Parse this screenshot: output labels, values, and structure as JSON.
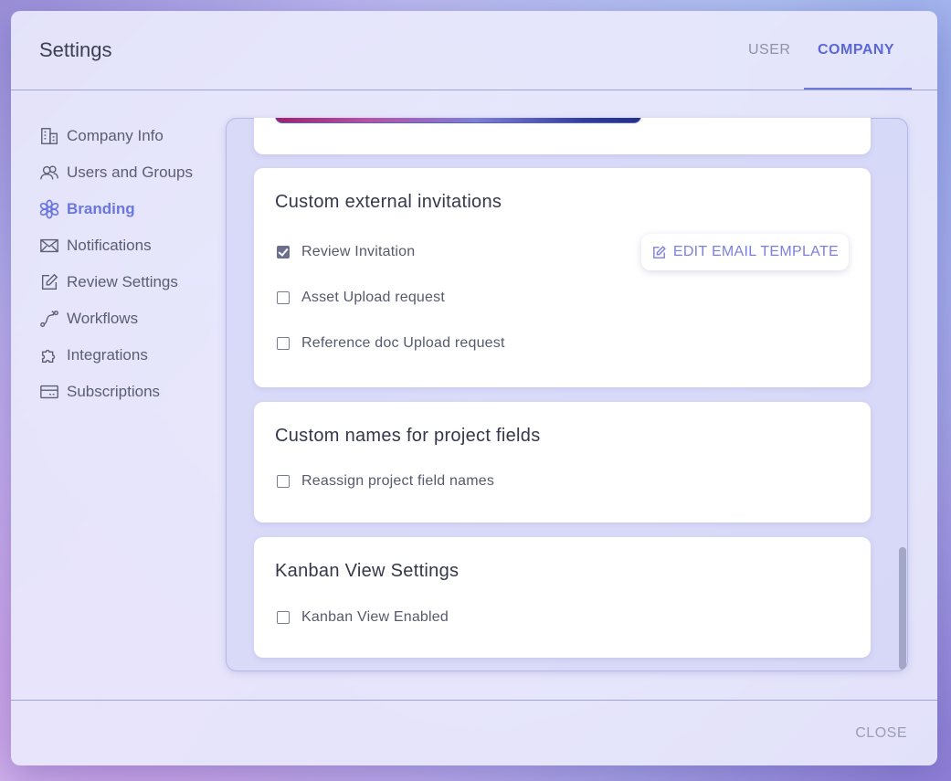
{
  "dialog": {
    "title": "Settings",
    "tabs": [
      {
        "label": "USER",
        "active": false
      },
      {
        "label": "COMPANY",
        "active": true
      }
    ],
    "close_label": "CLOSE"
  },
  "sidebar": {
    "items": [
      {
        "label": "Company Info",
        "icon": "building-icon"
      },
      {
        "label": "Users and Groups",
        "icon": "users-icon"
      },
      {
        "label": "Branding",
        "icon": "flower-icon",
        "active": true
      },
      {
        "label": "Notifications",
        "icon": "envelope-icon"
      },
      {
        "label": "Review Settings",
        "icon": "edit-icon"
      },
      {
        "label": "Workflows",
        "icon": "workflow-icon"
      },
      {
        "label": "Integrations",
        "icon": "puzzle-icon"
      },
      {
        "label": "Subscriptions",
        "icon": "credit-card-icon"
      }
    ]
  },
  "sections": {
    "invitations": {
      "title": "Custom external invitations",
      "edit_button_label": "EDIT EMAIL TEMPLATE",
      "options": [
        {
          "label": "Review Invitation",
          "checked": true
        },
        {
          "label": "Asset Upload request",
          "checked": false
        },
        {
          "label": "Reference doc Upload request",
          "checked": false
        }
      ]
    },
    "project_fields": {
      "title": "Custom names for project fields",
      "options": [
        {
          "label": "Reassign project field names",
          "checked": false
        }
      ]
    },
    "kanban": {
      "title": "Kanban View Settings",
      "options": [
        {
          "label": "Kanban View Enabled",
          "checked": false
        }
      ]
    }
  },
  "colors": {
    "accent": "#6b77dc",
    "branding_gradient": [
      "#a0206f",
      "#b552a6",
      "#7d7fd6",
      "#2f3c9e"
    ]
  }
}
